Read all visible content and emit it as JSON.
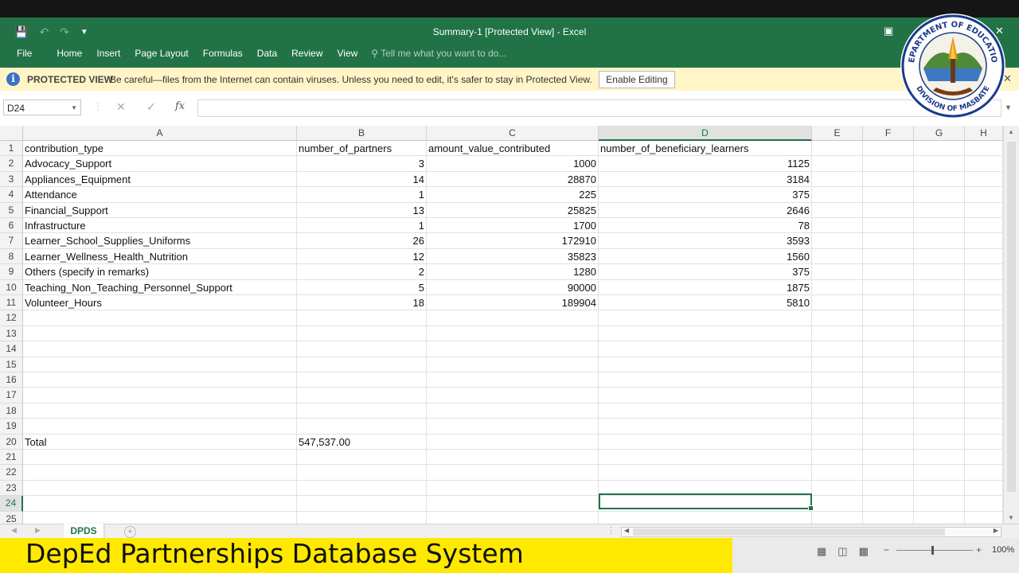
{
  "window": {
    "title": "Summary-1  [Protected View] - Excel"
  },
  "menus": [
    "Home",
    "Insert",
    "Page Layout",
    "Formulas",
    "Data",
    "Review",
    "View"
  ],
  "file_label": "File",
  "tell_me": "Tell me what you want to do...",
  "protected_bar": {
    "label": "PROTECTED VIEW",
    "message": "Be careful—files from the Internet can contain viruses. Unless you need to edit, it's safer to stay in Protected View.",
    "button": "Enable Editing"
  },
  "formula_bar": {
    "name_box": "D24",
    "fx": "fx",
    "content": ""
  },
  "columns": [
    "A",
    "B",
    "C",
    "D",
    "E",
    "F",
    "G",
    "H"
  ],
  "selected_column": "D",
  "rows": [
    "1",
    "2",
    "3",
    "4",
    "5",
    "6",
    "7",
    "8",
    "9",
    "10",
    "11",
    "12",
    "13",
    "14",
    "15",
    "16",
    "17",
    "18",
    "19",
    "20",
    "21",
    "22",
    "23",
    "24",
    "25"
  ],
  "selected_row": "24",
  "headers": [
    "contribution_type",
    "number_of_partners",
    "amount_value_contributed",
    "number_of_beneficiary_learners"
  ],
  "data_rows": [
    [
      "Advocacy_Support",
      "3",
      "1000",
      "1125"
    ],
    [
      "Appliances_Equipment",
      "14",
      "28870",
      "3184"
    ],
    [
      "Attendance",
      "1",
      "225",
      "375"
    ],
    [
      "Financial_Support",
      "13",
      "25825",
      "2646"
    ],
    [
      "Infrastructure",
      "1",
      "1700",
      "78"
    ],
    [
      "Learner_School_Supplies_Uniforms",
      "26",
      "172910",
      "3593"
    ],
    [
      "Learner_Wellness_Health_Nutrition",
      "12",
      "35823",
      "1560"
    ],
    [
      "Others (specify in remarks)",
      "2",
      "1280",
      "375"
    ],
    [
      "Teaching_Non_Teaching_Personnel_Support",
      "5",
      "90000",
      "1875"
    ],
    [
      "Volunteer_Hours",
      "18",
      "189904",
      "5810"
    ]
  ],
  "total_row": {
    "label": "Total",
    "value": "547,537.00"
  },
  "sheet_tab": "DPDS",
  "zoom": "100%",
  "caption": "DepEd Partnerships Database System",
  "logo": {
    "top_text": "DEPARTMENT OF EDUCATION",
    "bottom_text": "DIVISION OF MASBATE"
  }
}
